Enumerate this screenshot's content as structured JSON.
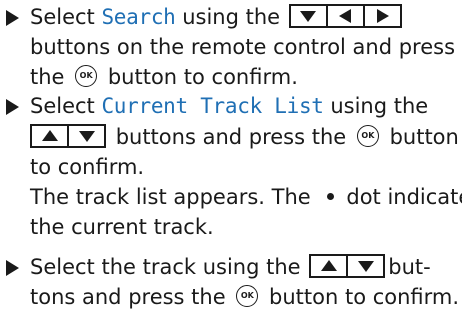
{
  "steps": [
    {
      "line1_pre": "Select ",
      "menu": "Search",
      "line1_post": " using the",
      "line2": "buttons on the remote control and press",
      "line3_pre": "the",
      "line3_post": "button to confirm."
    },
    {
      "line1_pre": "Select ",
      "menu": "Current Track List",
      "line1_post": " using the",
      "line2_post": "buttons and press the",
      "line2_end": "button",
      "line3": "to confirm.",
      "line4": "The track list appears. The",
      "line4_post": "dot indicates",
      "line5": "the current track."
    },
    {
      "line1_pre": "Select the track using the",
      "line1_post": "but-",
      "line2_pre": "tons and press the",
      "line2_post": "button to confirm."
    }
  ],
  "ok_label": "OK",
  "icons": {
    "bullet": "triangle-right",
    "key_down": "down-arrow",
    "key_left": "left-arrow",
    "key_right": "right-arrow",
    "key_up": "up-arrow",
    "ok_button": "ok-circle",
    "current_track_dot": "filled-dot"
  },
  "colors": {
    "menu_text": "#1f6fb4",
    "body_text": "#1a1a1a"
  }
}
